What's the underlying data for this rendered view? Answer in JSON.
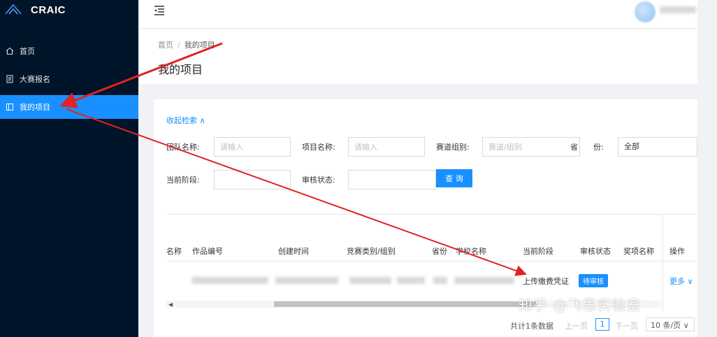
{
  "app": {
    "name": "CRAIC"
  },
  "sidebar": {
    "items": [
      {
        "label": "首页"
      },
      {
        "label": "大赛报名"
      },
      {
        "label": "我的项目"
      }
    ]
  },
  "breadcrumb": {
    "home": "首页",
    "separator": "/",
    "current": "我的项目"
  },
  "page": {
    "title": "我的项目"
  },
  "search": {
    "collapse_label": "收起检索 ∧",
    "team_name": {
      "label": "团队名称:",
      "placeholder": "请输入"
    },
    "project_name": {
      "label": "项目名称:",
      "placeholder": "请输入"
    },
    "track_group": {
      "label": "赛道组别:",
      "placeholder": "赛道/组别"
    },
    "province": {
      "label": "省　　份:",
      "value": "全部"
    },
    "current_stage": {
      "label": "当前阶段:"
    },
    "review_status": {
      "label": "审核状态:"
    },
    "query_button": "查 询"
  },
  "table": {
    "columns": [
      "名称",
      "作品编号",
      "创建时间",
      "竞赛类别/组别",
      "省份",
      "学校名称",
      "当前阶段",
      "审核状态",
      "奖项名称",
      "操作"
    ],
    "rows": [
      {
        "stage": "上传缴费凭证",
        "status": "待审核",
        "action": "更多 ∨"
      }
    ]
  },
  "pagination": {
    "total": "共计1条数据",
    "prev": "上一页",
    "page": "1",
    "next": "下一页",
    "page_size": "10 条/页 ∨"
  },
  "watermark": "知乎 @飞思实验室",
  "colors": {
    "sidebar_bg": "#001529",
    "accent": "#1890ff",
    "annotation": "#e32222"
  }
}
